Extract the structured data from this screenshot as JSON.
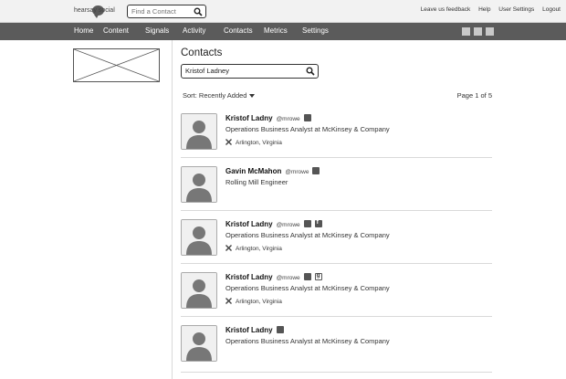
{
  "app": {
    "logo_text": "hearsay social",
    "find_placeholder": "Find a Contact",
    "top_links": [
      "Leave us feedback",
      "Help",
      "User Settings",
      "Logout"
    ]
  },
  "nav": {
    "items": [
      "Home",
      "Content",
      "Signals",
      "Activity",
      "Contacts",
      "Metrics",
      "Settings"
    ]
  },
  "page": {
    "title": "Contacts",
    "search_value": "Kristof Ladney",
    "sort_label": "Sort: Recently Added",
    "pagination": "Page 1 of 5"
  },
  "contacts": [
    {
      "name": "Kristof Ladny",
      "handle": "@mrowe",
      "title": "Operations Business Analyst at McKinsey & Company",
      "location": "Arlington, Virginia"
    },
    {
      "name": "Gavin McMahon",
      "handle": "@mrowe",
      "title": "Rolling Mill Engineer",
      "location": ""
    },
    {
      "name": "Kristof Ladny",
      "handle": "@mrowe",
      "title": "Operations Business Analyst at McKinsey & Company",
      "location": "Arlington, Virginia"
    },
    {
      "name": "Kristof Ladny",
      "handle": "@mrowe",
      "title": "Operations Business Analyst at McKinsey & Company",
      "location": "Arlington, Virginia"
    },
    {
      "name": "Kristof Ladny",
      "handle": "",
      "title": "Operations Business Analyst at McKinsey & Company",
      "location": ""
    }
  ],
  "icons": {
    "search": "search-icon",
    "social_twitter": "twitter-icon",
    "social_facebook": "facebook-icon",
    "social_google": "google-plus-icon",
    "location": "location-icon",
    "avatar": "avatar-placeholder"
  },
  "colors": {
    "nav_bg": "#5b5b5b",
    "topbar_bg": "#f2f2f2"
  }
}
